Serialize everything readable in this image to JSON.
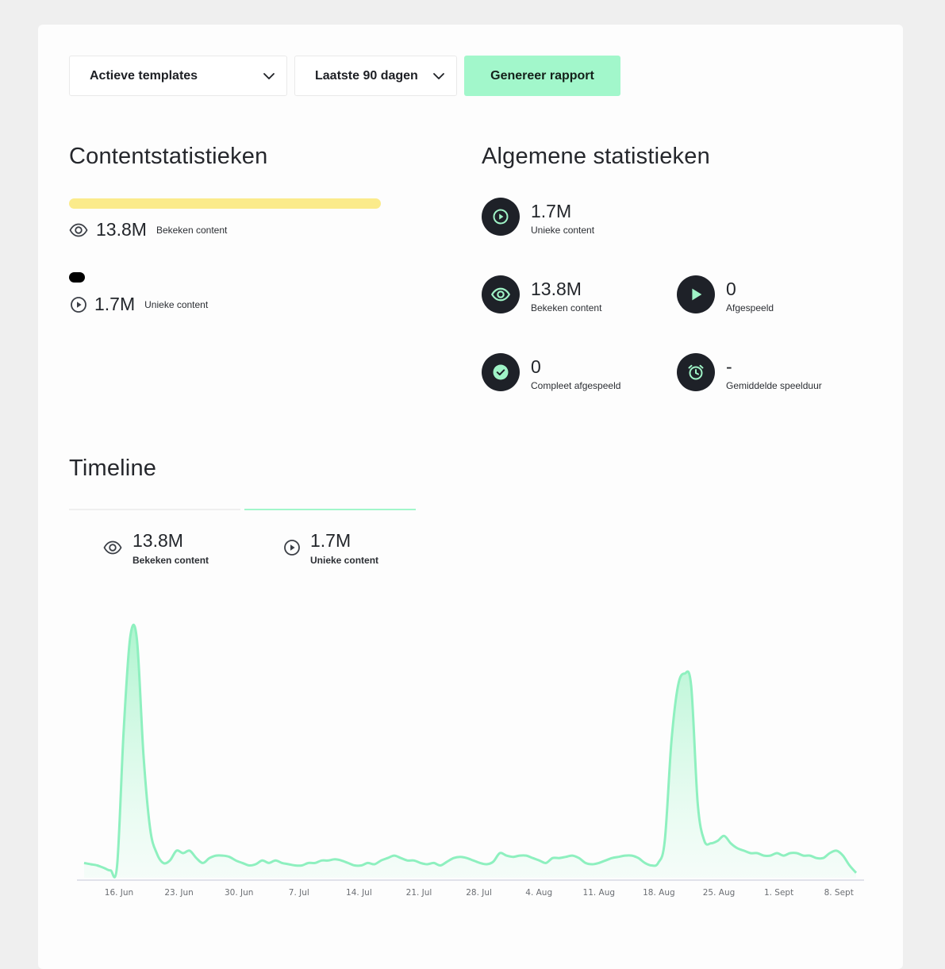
{
  "toolbar": {
    "template_select": "Actieve templates",
    "period_select": "Laatste 90 dagen",
    "generate_button": "Genereer rapport"
  },
  "content_stats": {
    "title": "Contentstatistieken",
    "items": [
      {
        "value": "13.8M",
        "label": "Bekeken content",
        "bar_color": "#fbeb8b",
        "icon": "eye-icon"
      },
      {
        "value": "1.7M",
        "label": "Unieke content",
        "bar_color": "#000000",
        "icon": "play-circle-icon"
      }
    ]
  },
  "general_stats": {
    "title": "Algemene statistieken",
    "items": [
      {
        "value": "1.7M",
        "label": "Unieke content",
        "icon": "play-circle-icon"
      },
      {
        "value": "13.8M",
        "label": "Bekeken content",
        "icon": "eye-icon"
      },
      {
        "value": "0",
        "label": "Afgespeeld",
        "icon": "play-icon"
      },
      {
        "value": "0",
        "label": "Compleet afgespeeld",
        "icon": "check-circle-icon"
      },
      {
        "value": "-",
        "label": "Gemiddelde speelduur",
        "icon": "alarm-clock-icon"
      }
    ]
  },
  "timeline": {
    "title": "Timeline",
    "tabs": [
      {
        "value": "13.8M",
        "label": "Bekeken content",
        "icon": "eye-icon"
      },
      {
        "value": "1.7M",
        "label": "Unieke content",
        "icon": "play-circle-icon",
        "active": true
      }
    ]
  },
  "colors": {
    "accent": "#a2f7cb",
    "line": "#8ef0bf",
    "dark": "#1e2128",
    "yellow": "#fbeb8b"
  },
  "chart_data": {
    "type": "area",
    "series": [
      {
        "values": [
          0.06,
          0.055,
          0.05,
          0.04,
          0.03,
          0.05,
          0.6,
          0.98,
          0.97,
          0.5,
          0.2,
          0.1,
          0.06,
          0.07,
          0.11,
          0.1,
          0.11,
          0.08,
          0.06,
          0.08,
          0.09,
          0.09,
          0.085,
          0.07,
          0.06,
          0.05,
          0.055,
          0.07,
          0.06,
          0.07,
          0.06,
          0.055,
          0.05,
          0.05,
          0.06,
          0.06,
          0.07,
          0.07,
          0.075,
          0.07,
          0.06,
          0.05,
          0.05,
          0.06,
          0.055,
          0.07,
          0.08,
          0.09,
          0.08,
          0.07,
          0.07,
          0.06,
          0.055,
          0.06,
          0.05,
          0.065,
          0.08,
          0.085,
          0.08,
          0.07,
          0.06,
          0.055,
          0.065,
          0.1,
          0.09,
          0.085,
          0.09,
          0.09,
          0.08,
          0.07,
          0.06,
          0.08,
          0.08,
          0.085,
          0.09,
          0.08,
          0.06,
          0.055,
          0.06,
          0.07,
          0.08,
          0.085,
          0.09,
          0.09,
          0.08,
          0.06,
          0.05,
          0.06,
          0.15,
          0.55,
          0.78,
          0.83,
          0.78,
          0.3,
          0.15,
          0.14,
          0.15,
          0.17,
          0.14,
          0.12,
          0.11,
          0.1,
          0.1,
          0.09,
          0.09,
          0.1,
          0.09,
          0.1,
          0.1,
          0.09,
          0.09,
          0.08,
          0.08,
          0.1,
          0.11,
          0.09,
          0.05,
          0.02
        ]
      }
    ],
    "x_ticks": [
      "16. Jun",
      "23. Jun",
      "30. Jun",
      "7. Jul",
      "14. Jul",
      "21. Jul",
      "28. Jul",
      "4. Aug",
      "11. Aug",
      "18. Aug",
      "25. Aug",
      "1. Sept",
      "8. Sept"
    ],
    "grid": false,
    "title": "",
    "xlabel": "",
    "ylabel": ""
  }
}
